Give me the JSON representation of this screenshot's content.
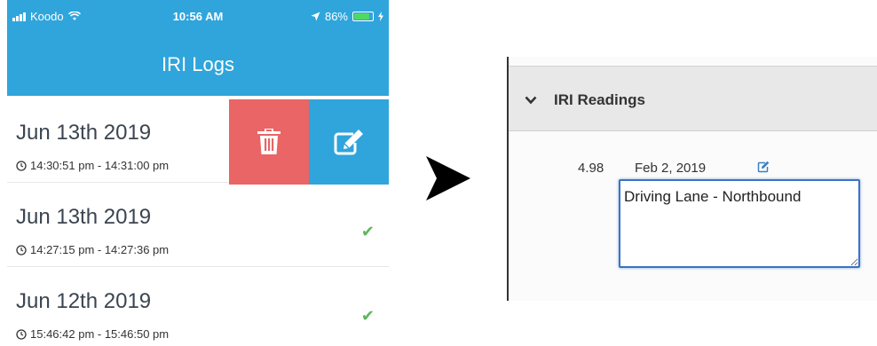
{
  "status_bar": {
    "carrier": "Koodo",
    "time": "10:56 AM",
    "battery_percent": "86%",
    "battery_level": 0.86,
    "icons": [
      "signal-icon",
      "wifi-icon",
      "location-arrow-icon",
      "battery-icon",
      "charging-icon"
    ]
  },
  "nav": {
    "title": "IRI Logs"
  },
  "logs": [
    {
      "date": "Jun 13th 2019",
      "time_range": "14:30:51 pm - 14:31:00 pm",
      "synced": false
    },
    {
      "date": "Jun 13th 2019",
      "time_range": "14:27:15 pm - 14:27:36 pm",
      "synced": true
    },
    {
      "date": "Jun 12th 2019",
      "time_range": "15:46:42 pm - 15:46:50 pm",
      "synced": true
    }
  ],
  "swipe_actions": {
    "delete_icon": "trash-icon",
    "edit_icon": "edit-icon"
  },
  "colors": {
    "accent": "#2fa5db",
    "delete": "#e96566",
    "check": "#5cb85c",
    "focus": "#3a72c7"
  },
  "web_panel": {
    "title": "IRI Readings",
    "reading": {
      "value": "4.98",
      "date": "Feb 2, 2019",
      "note": "Driving Lane - Northbound"
    }
  }
}
